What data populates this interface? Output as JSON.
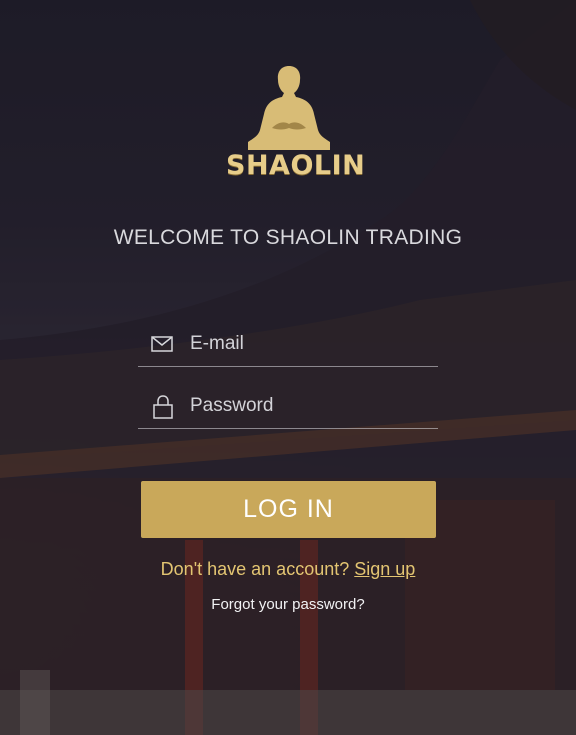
{
  "brand": {
    "name": "SHAOLIN",
    "logo_icon": "meditating-monk-icon",
    "accent_color": "#c9a85a",
    "text_gold": "#e3c572"
  },
  "welcome_text": "WELCOME TO SHAOLIN TRADING",
  "form": {
    "email": {
      "placeholder": "E-mail",
      "value": "",
      "icon": "envelope-icon"
    },
    "password": {
      "placeholder": "Password",
      "value": "",
      "icon": "lock-icon"
    },
    "login_label": "LOG IN"
  },
  "footer": {
    "signup_prompt": "Don't have an account?",
    "signup_link": "Sign up",
    "forgot_password": "Forgot your password?"
  }
}
